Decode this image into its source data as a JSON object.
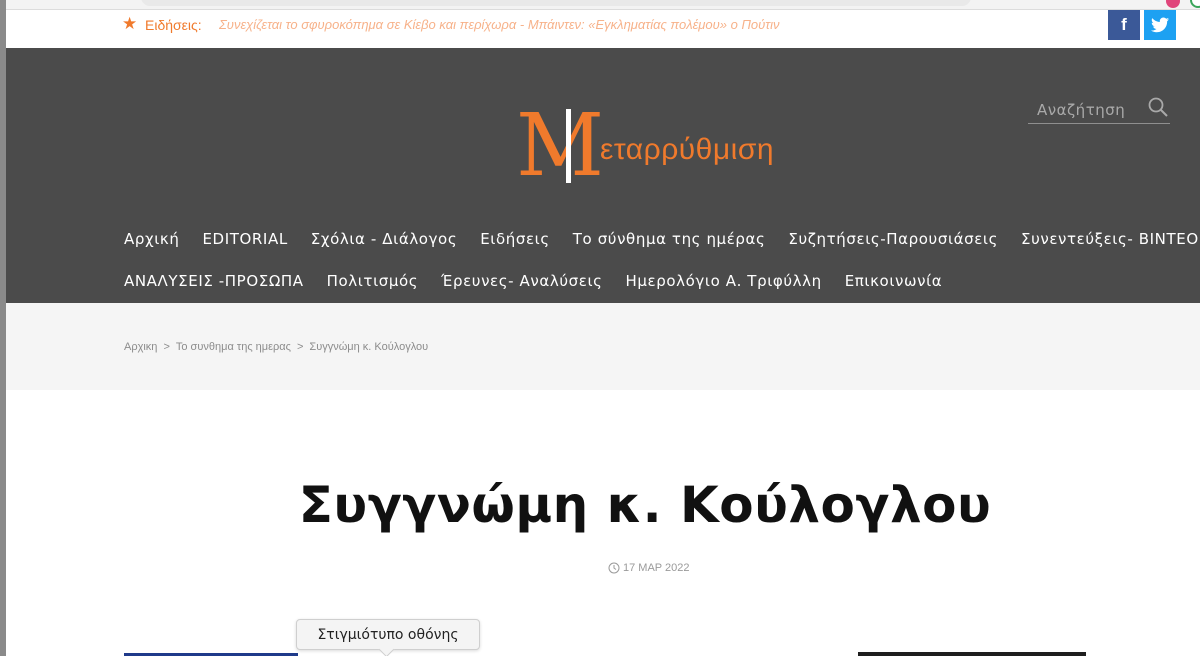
{
  "ticker": {
    "label": "Ειδήσεις:",
    "headline": "Συνεχίζεται το σφυροκόπημα σε Κίεβο και περίχωρα - Μπάιντεν: «Εγκληματίας πολέμου» ο Πούτιν",
    "facebook_glyph": "f",
    "twitter_glyph": "t",
    "accent_color": "#f07a2c"
  },
  "header": {
    "logo_letter": "M",
    "logo_word": "εταρρύθμιση",
    "search_placeholder": "Αναζήτηση",
    "background_color": "#4b4b4b"
  },
  "nav": {
    "row1": [
      "Αρχική",
      "EDITORIAL",
      "Σχόλια - Διάλογος",
      "Ειδήσεις",
      "Το σύνθημα της ημέρας",
      "Συζητήσεις-Παρουσιάσεις",
      "Συνεντεύξεις- ΒΙΝΤΕΟ"
    ],
    "row2": [
      "ΑΝΑΛΥΣΕΙΣ -ΠΡΟΣΩΠΑ",
      "Πολιτισμός",
      "Έρευνες- Αναλύσεις",
      "Ημερολόγιο Α. Τριφύλλη",
      "Επικοινωνία"
    ]
  },
  "breadcrumb": {
    "items": [
      "Αρχικη",
      "Το συνθημα της ημερας",
      "Συγγνώμη κ. Κούλογλου"
    ],
    "separator": ">"
  },
  "article": {
    "title": "Συγγνώμη κ. Κούλογλου",
    "date": "17 ΜΑΡ 2022"
  },
  "tooltip": {
    "text": "Στιγμιότυπο οθόνης"
  }
}
